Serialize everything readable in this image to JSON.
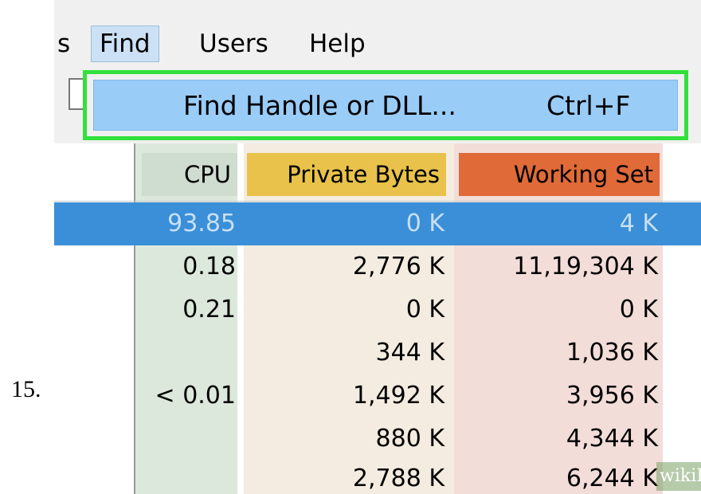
{
  "step": {
    "number": "15."
  },
  "menubar": {
    "items": [
      {
        "label": "s"
      },
      {
        "label": "Find",
        "active": true
      },
      {
        "label": "Users"
      },
      {
        "label": "Help"
      }
    ]
  },
  "find_menu": {
    "item_label": "Find Handle or DLL...",
    "shortcut": "Ctrl+F",
    "highlight_color": "#32e03c"
  },
  "process_table": {
    "columns": [
      {
        "label": "CPU",
        "color": "#cfdcd0"
      },
      {
        "label": "Private Bytes",
        "color": "#e8c24a"
      },
      {
        "label": "Working Set",
        "color": "#e06a38"
      }
    ],
    "rows": [
      {
        "cpu": "93.85",
        "private_bytes": "0 K",
        "working_set": "4 K",
        "selected": true
      },
      {
        "cpu": "0.18",
        "private_bytes": "2,776 K",
        "working_set": "11,19,304 K"
      },
      {
        "cpu": "0.21",
        "private_bytes": "0 K",
        "working_set": "0 K"
      },
      {
        "cpu": "",
        "private_bytes": "344 K",
        "working_set": "1,036 K"
      },
      {
        "cpu": "< 0.01",
        "private_bytes": "1,492 K",
        "working_set": "3,956 K"
      },
      {
        "cpu": "",
        "private_bytes": "880 K",
        "working_set": "4,344 K"
      },
      {
        "cpu": "",
        "private_bytes": "2,788 K",
        "working_set": "6,244 K"
      }
    ]
  },
  "watermark": {
    "text": "wikiHow"
  }
}
